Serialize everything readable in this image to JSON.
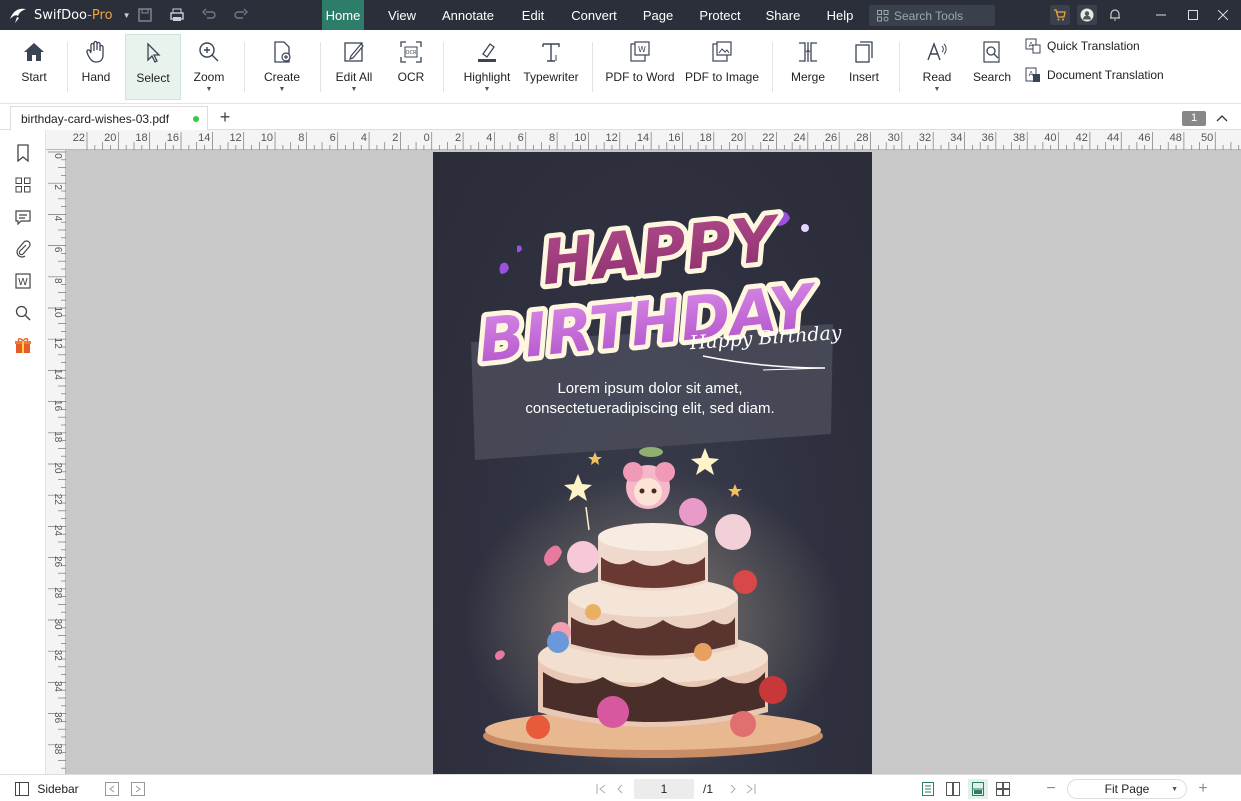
{
  "app": {
    "name": "SwifDoo",
    "edition": "-Pro"
  },
  "menu": {
    "items": [
      "Home",
      "View",
      "Annotate",
      "Edit",
      "Convert",
      "Page",
      "Protect",
      "Share",
      "Help"
    ],
    "active": "Home"
  },
  "search": {
    "placeholder": "Search Tools"
  },
  "ribbon": {
    "start": "Start",
    "hand": "Hand",
    "select": "Select",
    "zoom": "Zoom",
    "create": "Create",
    "edit_all": "Edit All",
    "ocr": "OCR",
    "highlight": "Highlight",
    "typewriter": "Typewriter",
    "pdf_to_word": "PDF to Word",
    "pdf_to_image": "PDF to Image",
    "merge": "Merge",
    "insert": "Insert",
    "read": "Read",
    "search": "Search",
    "quick_translation": "Quick Translation",
    "document_translation": "Document Translation"
  },
  "tab": {
    "filename": "birthday-card-wishes-03.pdf",
    "page_badge": "1"
  },
  "ruler": {
    "h_ticks": [
      "22",
      "20",
      "18",
      "16",
      "14",
      "12",
      "10",
      "8",
      "6",
      "4",
      "2",
      "0",
      "2",
      "4",
      "6",
      "8",
      "10",
      "12",
      "14",
      "16",
      "18",
      "20",
      "22",
      "24",
      "26",
      "28",
      "30",
      "32",
      "34",
      "36",
      "38",
      "40",
      "42",
      "44",
      "46",
      "48",
      "50"
    ],
    "v_ticks": [
      "0",
      "2",
      "4",
      "6",
      "8",
      "10",
      "12",
      "14",
      "16",
      "18",
      "20",
      "22",
      "24",
      "26",
      "28",
      "30",
      "32",
      "34",
      "36",
      "38"
    ]
  },
  "card": {
    "title_line1": "HAPPY",
    "title_line2": "BIRTHDAY",
    "script": "Happy Birthday",
    "body_line1": "Lorem ipsum dolor sit amet,",
    "body_line2": "consectetueradipiscing elit, sed diam.",
    "colors": {
      "bg": "#2f3140",
      "title_top": "#a83e84",
      "title_bottom": "#c86ad8",
      "outline": "#fff6e0"
    }
  },
  "status": {
    "sidebar": "Sidebar",
    "page_current": "1",
    "page_total": "/1",
    "zoom": "Fit Page"
  }
}
